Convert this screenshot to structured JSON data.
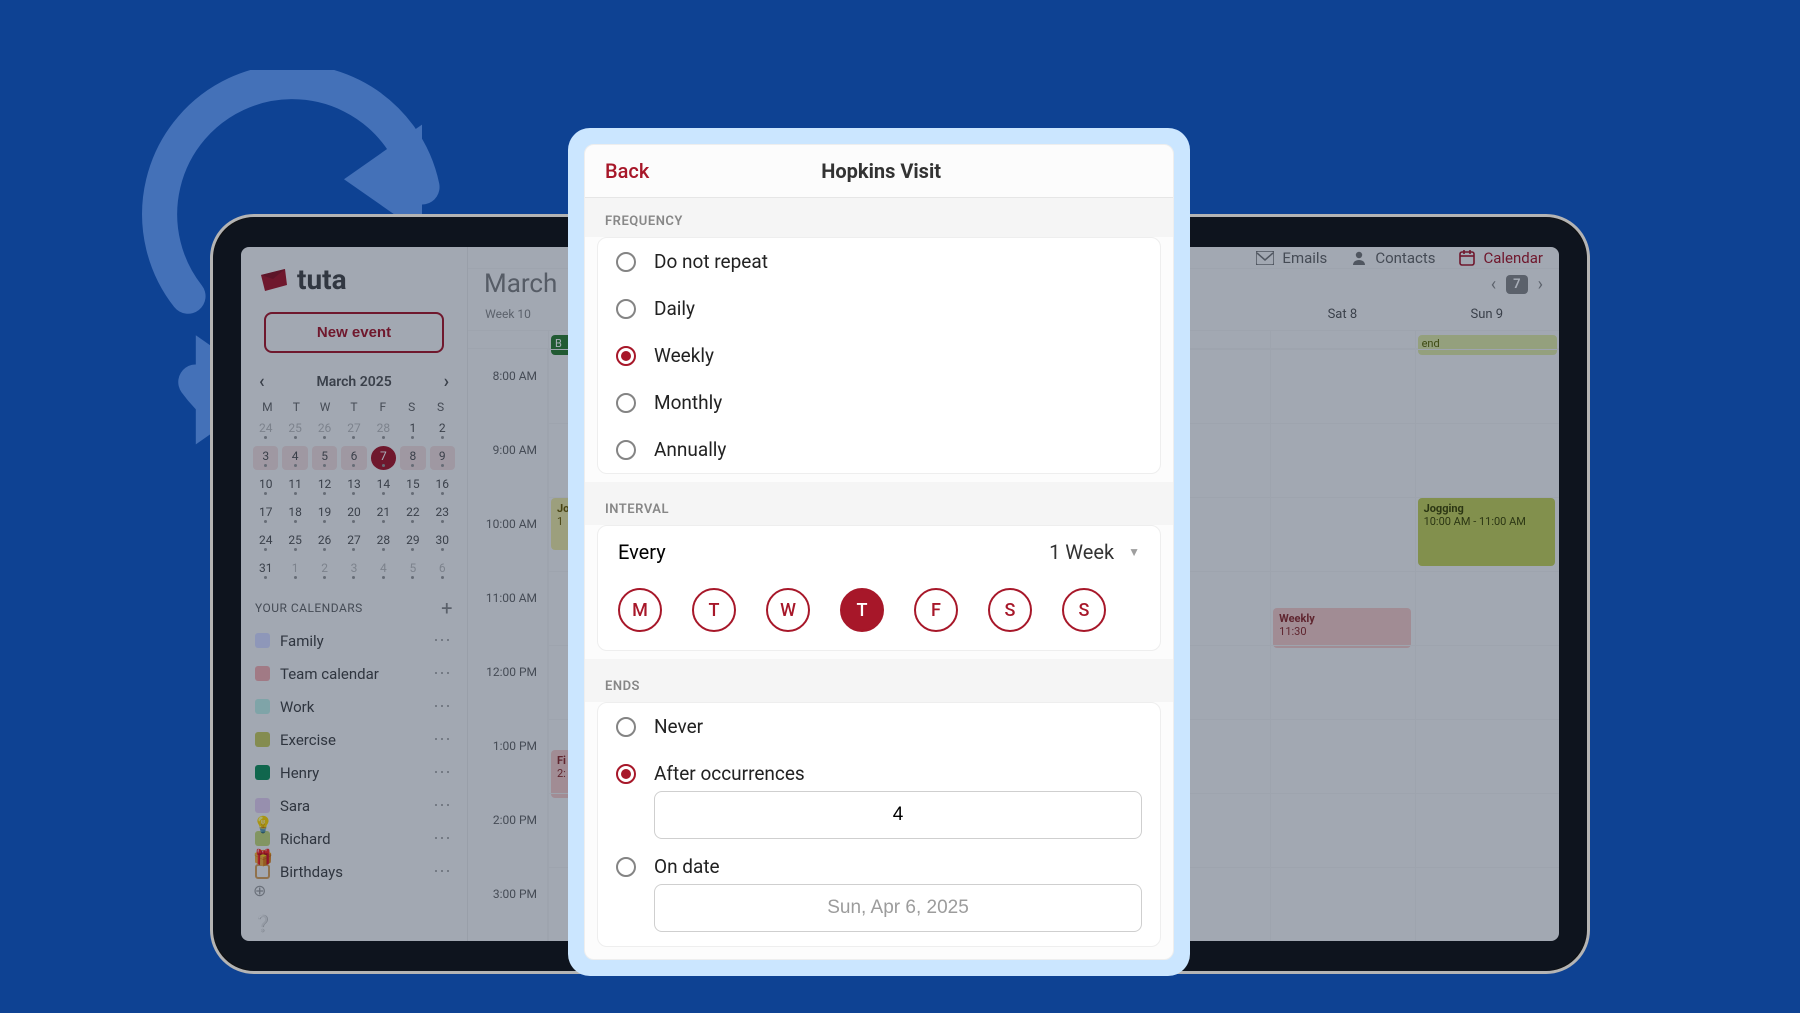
{
  "brand": "tuta",
  "colors": {
    "accent": "#a71729",
    "bg": "#0e4293"
  },
  "buttons": {
    "new_event": "New event"
  },
  "mini_calendar": {
    "title": "March 2025",
    "dow": [
      "M",
      "T",
      "W",
      "T",
      "F",
      "S",
      "S"
    ],
    "weeks": [
      [
        {
          "n": 24,
          "muted": true
        },
        {
          "n": 25,
          "muted": true
        },
        {
          "n": 26,
          "muted": true
        },
        {
          "n": 27,
          "muted": true
        },
        {
          "n": 28,
          "muted": true
        },
        {
          "n": 1
        },
        {
          "n": 2
        }
      ],
      [
        {
          "n": 3,
          "hl": true
        },
        {
          "n": 4,
          "hl": true
        },
        {
          "n": 5,
          "hl": true
        },
        {
          "n": 6,
          "hl": true
        },
        {
          "n": 7,
          "hl": true,
          "sel": true
        },
        {
          "n": 8,
          "hl": true
        },
        {
          "n": 9,
          "hl": true
        }
      ],
      [
        {
          "n": 10
        },
        {
          "n": 11
        },
        {
          "n": 12
        },
        {
          "n": 13
        },
        {
          "n": 14
        },
        {
          "n": 15
        },
        {
          "n": 16
        }
      ],
      [
        {
          "n": 17
        },
        {
          "n": 18
        },
        {
          "n": 19
        },
        {
          "n": 20
        },
        {
          "n": 21
        },
        {
          "n": 22
        },
        {
          "n": 23
        }
      ],
      [
        {
          "n": 24
        },
        {
          "n": 25
        },
        {
          "n": 26
        },
        {
          "n": 27
        },
        {
          "n": 28
        },
        {
          "n": 29
        },
        {
          "n": 30
        }
      ],
      [
        {
          "n": 31
        },
        {
          "n": 1,
          "muted": true
        },
        {
          "n": 2,
          "muted": true
        },
        {
          "n": 3,
          "muted": true
        },
        {
          "n": 4,
          "muted": true
        },
        {
          "n": 5,
          "muted": true
        },
        {
          "n": 6,
          "muted": true
        }
      ]
    ]
  },
  "your_calendars_label": "YOUR CALENDARS",
  "calendars": [
    {
      "name": "Family",
      "color": "#d6dbff"
    },
    {
      "name": "Team calendar",
      "color": "#f3aeb0"
    },
    {
      "name": "Work",
      "color": "#bfeee5"
    },
    {
      "name": "Exercise",
      "color": "#c6c95e"
    },
    {
      "name": "Henry",
      "color": "#148f5a"
    },
    {
      "name": "Sara",
      "color": "#e3ceee"
    },
    {
      "name": "Richard",
      "color": "#c4d77a"
    },
    {
      "name": "Birthdays",
      "color": "#ffffff",
      "outline": true
    }
  ],
  "topbar": {
    "emails": "Emails",
    "contacts": "Contacts",
    "calendar": "Calendar"
  },
  "view": {
    "month": "March",
    "range_chip": "7",
    "week_label": "Week 10",
    "days": [
      "",
      "",
      "",
      "",
      "",
      "Sat  8",
      "Sun  9"
    ],
    "times": [
      "8:00 AM",
      "9:00 AM",
      "10:00 AM",
      "11:00 AM",
      "12:00 PM",
      "1:00 PM",
      "2:00 PM",
      "3:00 PM"
    ],
    "allday": {
      "mon_badge": "B",
      "sun_pill": "end"
    },
    "events": {
      "mon_10": {
        "title": "Jo",
        "sub": "1"
      },
      "sun_10": {
        "title": "Jogging",
        "time": "10:00 AM - 11:00 AM"
      },
      "sat_11": {
        "title": "Weekly",
        "time": "11:30"
      },
      "mon_1": {
        "title": "Fi",
        "sub": "2:"
      }
    }
  },
  "modal": {
    "back": "Back",
    "title": "Hopkins Visit",
    "sections": {
      "frequency": "FREQUENCY",
      "interval": "INTERVAL",
      "ends": "ENDS"
    },
    "frequency": {
      "options": [
        "Do not repeat",
        "Daily",
        "Weekly",
        "Monthly",
        "Annually"
      ],
      "selected_index": 2
    },
    "interval": {
      "prefix": "Every",
      "value": "1 Week",
      "dow": [
        "M",
        "T",
        "W",
        "T",
        "F",
        "S",
        "S"
      ],
      "active_index": 3
    },
    "ends": {
      "options": [
        "Never",
        "After occurrences",
        "On date"
      ],
      "selected_index": 1,
      "occurrences_value": "4",
      "on_date_value": "Sun, Apr 6, 2025"
    }
  }
}
